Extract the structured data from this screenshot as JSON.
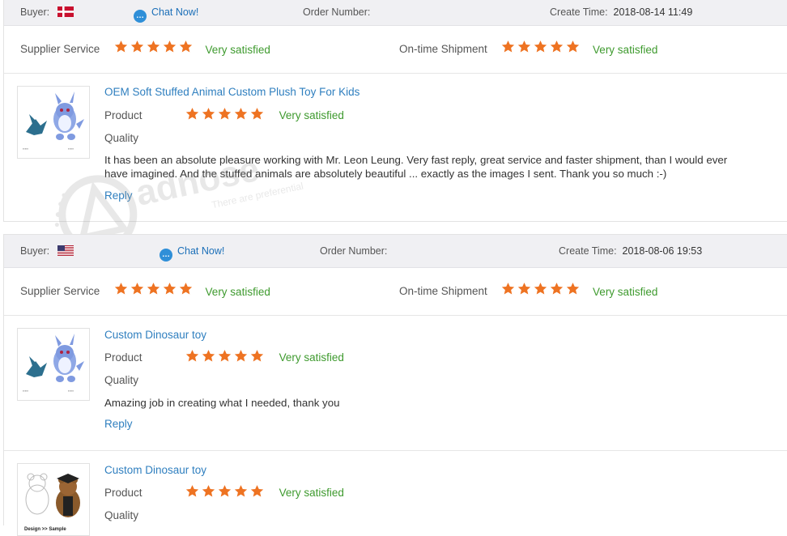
{
  "reviews": [
    {
      "buyer_label": "Buyer:",
      "buyer_flag": "flag-denmark",
      "chat_label": "Chat Now!",
      "order_label": "Order Number:",
      "create_label": "Create Time:",
      "create_time": "2018-08-14 11:49",
      "supplier_service_label": "Supplier Service",
      "supplier_service_rating": 5,
      "supplier_service_text": "Very satisfied",
      "shipment_label": "On-time Shipment",
      "shipment_rating": 5,
      "shipment_text": "Very satisfied",
      "products": [
        {
          "name": "OEM Soft Stuffed Animal Custom Plush Toy For Kids",
          "product_label": "Product",
          "quality_label": "Quality",
          "rating": 5,
          "rating_text": "Very satisfied",
          "comment": "It has been an absolute pleasure working with Mr. Leon Leung. Very fast reply, great service and faster shipment, than I would ever have imagined. And the stuffed animals are absolutely beautiful ... exactly as the images I sent. Thank you so much :-)",
          "reply_label": "Reply"
        }
      ]
    },
    {
      "buyer_label": "Buyer:",
      "buyer_flag": "flag-usa",
      "chat_label": "Chat Now!",
      "order_label": "Order Number:",
      "create_label": "Create Time:",
      "create_time": "2018-08-06 19:53",
      "supplier_service_label": "Supplier Service",
      "supplier_service_rating": 5,
      "supplier_service_text": "Very satisfied",
      "shipment_label": "On-time Shipment",
      "shipment_rating": 5,
      "shipment_text": "Very satisfied",
      "products": [
        {
          "name": "Custom Dinosaur toy",
          "product_label": "Product",
          "quality_label": "Quality",
          "rating": 5,
          "rating_text": "Very satisfied",
          "comment": "Amazing job in creating what I needed, thank you",
          "reply_label": "Reply"
        },
        {
          "name": "Custom Dinosaur toy",
          "product_label": "Product",
          "quality_label": "Quality",
          "rating": 5,
          "rating_text": "Very satisfied",
          "thumb_caption": "Design >> Sample"
        }
      ]
    }
  ],
  "watermark": {
    "brand": "adnose",
    "tagline": "There are preferential"
  },
  "colors": {
    "star": "#ee7322",
    "satisfied": "#3e9a2e",
    "link": "#2f7fbf",
    "header_bg": "#f0f0f3"
  }
}
